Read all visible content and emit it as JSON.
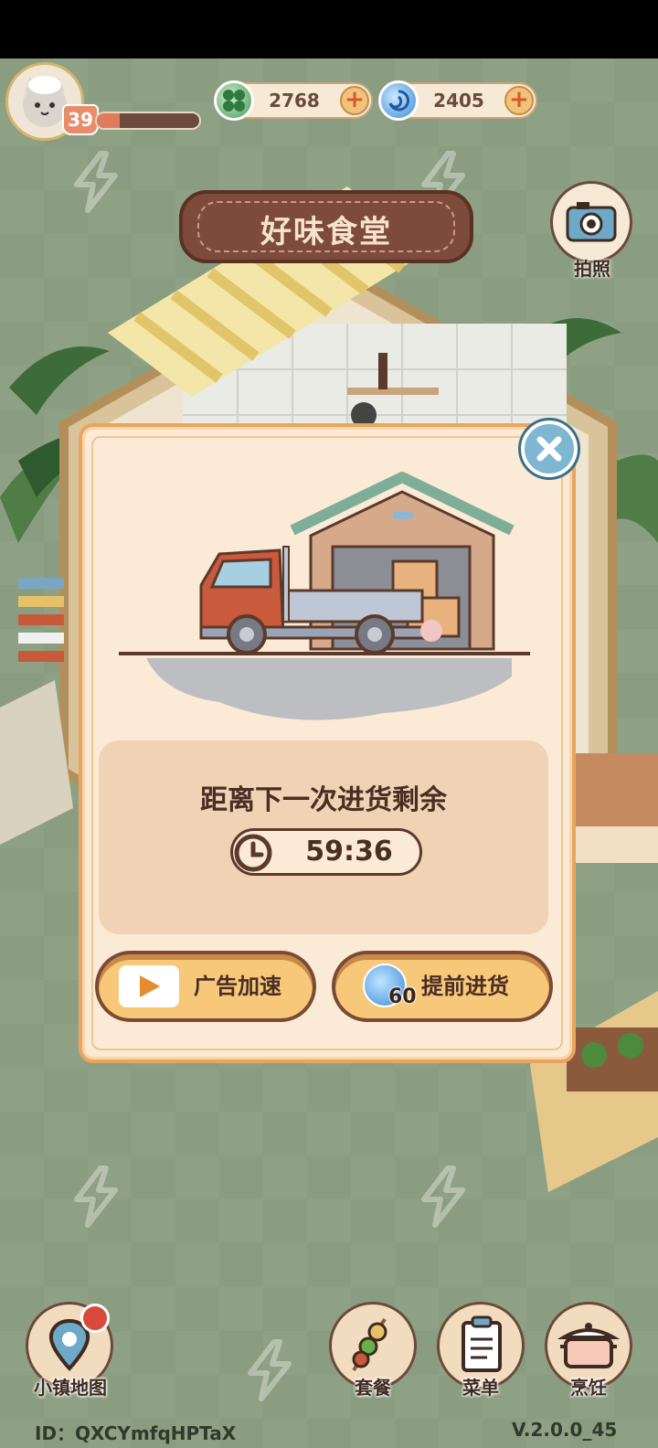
{
  "hud": {
    "level": "39",
    "xp_progress": 0.22,
    "clover_amount": "2768",
    "gem_amount": "2405"
  },
  "restaurant": {
    "sign": "好味食堂"
  },
  "camera": {
    "label": "拍照"
  },
  "restock_dialog": {
    "title": "距离下一次进货剩余",
    "countdown": "59:36",
    "ad_button_label": "广告加速",
    "early_button_label": "提前进货",
    "early_cost": "60"
  },
  "nav": {
    "map_label": "小镇地图",
    "combo_label": "套餐",
    "menu_label": "菜单",
    "cook_label": "烹饪"
  },
  "footer": {
    "id_text": "ID：QXCYmfqHPTaX",
    "version": "V.2.0.0_45"
  },
  "colors": {
    "background": "#8a9d80",
    "dialog_bg": "#fbead5",
    "dialog_border": "#e9a560",
    "button": "#f7c77a",
    "accent_brown": "#7a4a34"
  }
}
